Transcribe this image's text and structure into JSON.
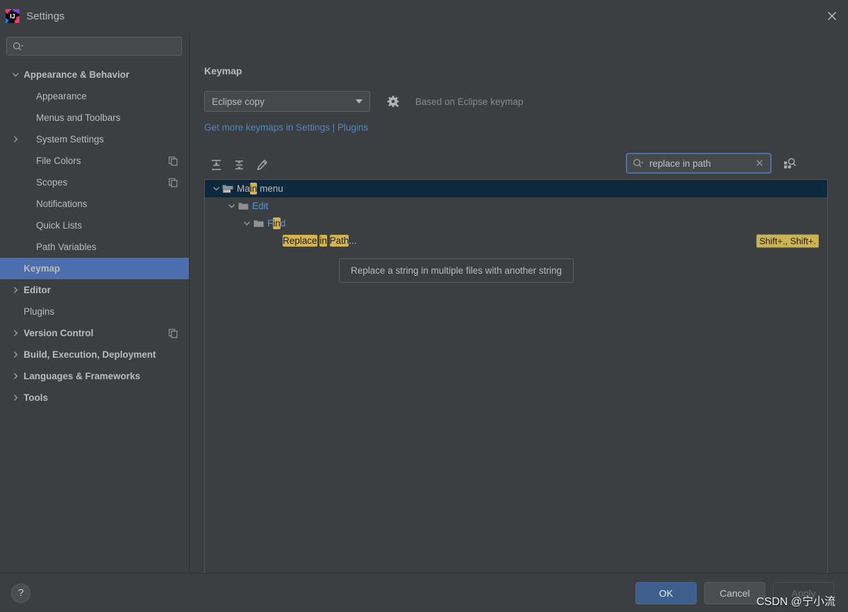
{
  "window": {
    "title": "Settings",
    "app_icon": "intellij-idea-logo",
    "close_icon": "close-icon"
  },
  "sidebar": {
    "search": {
      "value": "",
      "placeholder": "",
      "icon": "search-icon"
    },
    "items": [
      {
        "label": "Appearance & Behavior",
        "level": 0,
        "bold": true,
        "twisty": "expanded",
        "copy": false,
        "selected": false
      },
      {
        "label": "Appearance",
        "level": 1,
        "bold": false,
        "twisty": "none",
        "copy": false,
        "selected": false
      },
      {
        "label": "Menus and Toolbars",
        "level": 1,
        "bold": false,
        "twisty": "none",
        "copy": false,
        "selected": false
      },
      {
        "label": "System Settings",
        "level": 1,
        "bold": false,
        "twisty": "collapsed",
        "copy": false,
        "selected": false
      },
      {
        "label": "File Colors",
        "level": 1,
        "bold": false,
        "twisty": "none",
        "copy": true,
        "selected": false
      },
      {
        "label": "Scopes",
        "level": 1,
        "bold": false,
        "twisty": "none",
        "copy": true,
        "selected": false
      },
      {
        "label": "Notifications",
        "level": 1,
        "bold": false,
        "twisty": "none",
        "copy": false,
        "selected": false
      },
      {
        "label": "Quick Lists",
        "level": 1,
        "bold": false,
        "twisty": "none",
        "copy": false,
        "selected": false
      },
      {
        "label": "Path Variables",
        "level": 1,
        "bold": false,
        "twisty": "none",
        "copy": false,
        "selected": false
      },
      {
        "label": "Keymap",
        "level": 0,
        "bold": true,
        "twisty": "none",
        "copy": false,
        "selected": true
      },
      {
        "label": "Editor",
        "level": 0,
        "bold": true,
        "twisty": "collapsed",
        "copy": false,
        "selected": false
      },
      {
        "label": "Plugins",
        "level": 0,
        "bold": false,
        "twisty": "none",
        "copy": false,
        "selected": false
      },
      {
        "label": "Version Control",
        "level": 0,
        "bold": true,
        "twisty": "collapsed",
        "copy": true,
        "selected": false
      },
      {
        "label": "Build, Execution, Deployment",
        "level": 0,
        "bold": true,
        "twisty": "collapsed",
        "copy": false,
        "selected": false
      },
      {
        "label": "Languages & Frameworks",
        "level": 0,
        "bold": true,
        "twisty": "collapsed",
        "copy": false,
        "selected": false
      },
      {
        "label": "Tools",
        "level": 0,
        "bold": true,
        "twisty": "collapsed",
        "copy": false,
        "selected": false
      }
    ]
  },
  "content": {
    "title": "Keymap",
    "keymap_select": {
      "value": "Eclipse copy"
    },
    "gear_icon": "gear-icon",
    "based_on": "Based on Eclipse keymap",
    "plugins_link": "Get more keymaps in Settings | Plugins",
    "toolbar": {
      "expand_all": "expand-all-icon",
      "collapse_all": "collapse-all-icon",
      "edit": "edit-pencil-icon"
    },
    "find": {
      "value": "replace in path",
      "search_icon": "search-icon",
      "clear_icon": "clear-icon",
      "shortcut_search_icon": "find-by-shortcut-icon"
    },
    "tree": [
      {
        "label_parts": [
          {
            "t": "Ma",
            "h": false
          },
          {
            "t": "in",
            "h": true
          },
          {
            "t": " menu",
            "h": false
          }
        ],
        "indent": 0,
        "twisty": "expanded",
        "icon": "main-menu-folder-icon",
        "selected": true,
        "link": false,
        "shortcut": ""
      },
      {
        "label_parts": [
          {
            "t": "Edit",
            "h": false
          }
        ],
        "indent": 1,
        "twisty": "expanded",
        "icon": "folder-icon",
        "selected": false,
        "link": true,
        "shortcut": ""
      },
      {
        "label_parts": [
          {
            "t": "F",
            "h": false
          },
          {
            "t": "in",
            "h": true
          },
          {
            "t": "d",
            "h": false
          }
        ],
        "indent": 2,
        "twisty": "expanded",
        "icon": "folder-icon",
        "selected": false,
        "link": true,
        "shortcut": ""
      },
      {
        "label_parts": [
          {
            "t": "Replace",
            "h": true
          },
          {
            "t": " ",
            "h": false
          },
          {
            "t": "in",
            "h": true
          },
          {
            "t": " ",
            "h": false
          },
          {
            "t": "Path",
            "h": true
          },
          {
            "t": "...",
            "h": false
          }
        ],
        "indent": 3,
        "twisty": "none",
        "icon": "none",
        "selected": false,
        "link": false,
        "shortcut": "Shift+., Shift+."
      }
    ],
    "tooltip": "Replace a string in multiple files with another string"
  },
  "footer": {
    "help_label": "?",
    "help_icon": "help-icon",
    "ok": "OK",
    "cancel": "Cancel",
    "apply": "Apply",
    "watermark": "CSDN @宁小流"
  },
  "colors": {
    "background": "#3c3f41",
    "selection": "#4b6eaf",
    "tree_selection": "#0d293e",
    "link": "#4a88c7",
    "highlight": "#d6b34a",
    "focus_border": "#4b72ad",
    "primary_button": "#3c5f8e"
  }
}
